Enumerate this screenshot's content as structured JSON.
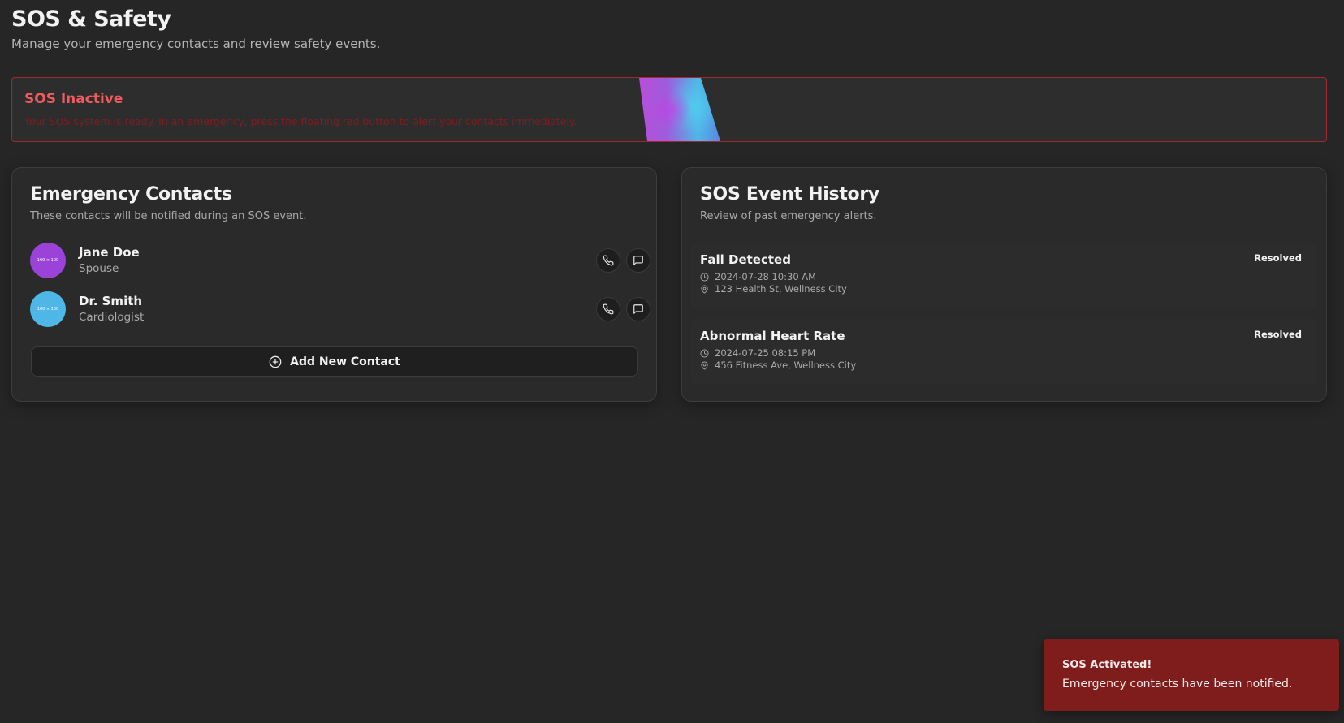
{
  "header": {
    "title": "SOS & Safety",
    "subtitle": "Manage your emergency contacts and review safety events."
  },
  "banner": {
    "title": "SOS Inactive",
    "text": "Your SOS system is ready. In an emergency, press the floating red button to alert your contacts immediately."
  },
  "contacts_card": {
    "title": "Emergency Contacts",
    "subtitle": "These contacts will be notified during an SOS event.",
    "contacts": [
      {
        "name": "Jane Doe",
        "role": "Spouse",
        "avatar_text": "100 × 100",
        "avatar_color": "#9b42d9"
      },
      {
        "name": "Dr. Smith",
        "role": "Cardiologist",
        "avatar_text": "100 × 100",
        "avatar_color": "#4fb7e8"
      }
    ],
    "add_label": "Add New Contact"
  },
  "history_card": {
    "title": "SOS Event History",
    "subtitle": "Review of past emergency alerts.",
    "events": [
      {
        "title": "Fall Detected",
        "status": "Resolved",
        "datetime": "2024-07-28 10:30 AM",
        "location": "123 Health St, Wellness City"
      },
      {
        "title": "Abnormal Heart Rate",
        "status": "Resolved",
        "datetime": "2024-07-25 08:15 PM",
        "location": "456 Fitness Ave, Wellness City"
      }
    ]
  },
  "toast": {
    "title": "SOS Activated!",
    "text": "Emergency contacts have been notified."
  },
  "colors": {
    "background": "#262626",
    "danger": "#ef5a5e",
    "toast_bg": "#7f1d1d"
  }
}
